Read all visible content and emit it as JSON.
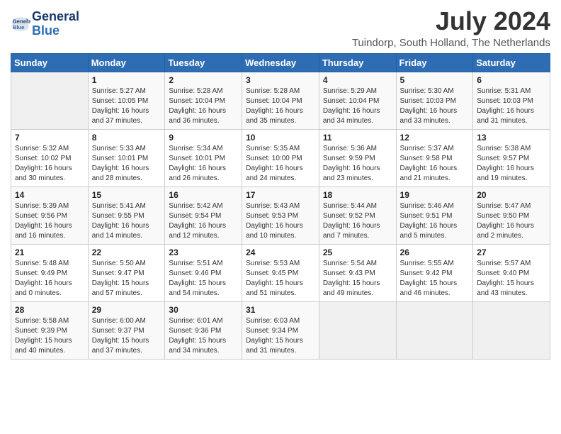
{
  "header": {
    "logo_line1": "General",
    "logo_line2": "Blue",
    "month_title": "July 2024",
    "location": "Tuindorp, South Holland, The Netherlands"
  },
  "days_of_week": [
    "Sunday",
    "Monday",
    "Tuesday",
    "Wednesday",
    "Thursday",
    "Friday",
    "Saturday"
  ],
  "weeks": [
    [
      {
        "day": "",
        "info": ""
      },
      {
        "day": "1",
        "info": "Sunrise: 5:27 AM\nSunset: 10:05 PM\nDaylight: 16 hours\nand 37 minutes."
      },
      {
        "day": "2",
        "info": "Sunrise: 5:28 AM\nSunset: 10:04 PM\nDaylight: 16 hours\nand 36 minutes."
      },
      {
        "day": "3",
        "info": "Sunrise: 5:28 AM\nSunset: 10:04 PM\nDaylight: 16 hours\nand 35 minutes."
      },
      {
        "day": "4",
        "info": "Sunrise: 5:29 AM\nSunset: 10:04 PM\nDaylight: 16 hours\nand 34 minutes."
      },
      {
        "day": "5",
        "info": "Sunrise: 5:30 AM\nSunset: 10:03 PM\nDaylight: 16 hours\nand 33 minutes."
      },
      {
        "day": "6",
        "info": "Sunrise: 5:31 AM\nSunset: 10:03 PM\nDaylight: 16 hours\nand 31 minutes."
      }
    ],
    [
      {
        "day": "7",
        "info": "Sunrise: 5:32 AM\nSunset: 10:02 PM\nDaylight: 16 hours\nand 30 minutes."
      },
      {
        "day": "8",
        "info": "Sunrise: 5:33 AM\nSunset: 10:01 PM\nDaylight: 16 hours\nand 28 minutes."
      },
      {
        "day": "9",
        "info": "Sunrise: 5:34 AM\nSunset: 10:01 PM\nDaylight: 16 hours\nand 26 minutes."
      },
      {
        "day": "10",
        "info": "Sunrise: 5:35 AM\nSunset: 10:00 PM\nDaylight: 16 hours\nand 24 minutes."
      },
      {
        "day": "11",
        "info": "Sunrise: 5:36 AM\nSunset: 9:59 PM\nDaylight: 16 hours\nand 23 minutes."
      },
      {
        "day": "12",
        "info": "Sunrise: 5:37 AM\nSunset: 9:58 PM\nDaylight: 16 hours\nand 21 minutes."
      },
      {
        "day": "13",
        "info": "Sunrise: 5:38 AM\nSunset: 9:57 PM\nDaylight: 16 hours\nand 19 minutes."
      }
    ],
    [
      {
        "day": "14",
        "info": "Sunrise: 5:39 AM\nSunset: 9:56 PM\nDaylight: 16 hours\nand 16 minutes."
      },
      {
        "day": "15",
        "info": "Sunrise: 5:41 AM\nSunset: 9:55 PM\nDaylight: 16 hours\nand 14 minutes."
      },
      {
        "day": "16",
        "info": "Sunrise: 5:42 AM\nSunset: 9:54 PM\nDaylight: 16 hours\nand 12 minutes."
      },
      {
        "day": "17",
        "info": "Sunrise: 5:43 AM\nSunset: 9:53 PM\nDaylight: 16 hours\nand 10 minutes."
      },
      {
        "day": "18",
        "info": "Sunrise: 5:44 AM\nSunset: 9:52 PM\nDaylight: 16 hours\nand 7 minutes."
      },
      {
        "day": "19",
        "info": "Sunrise: 5:46 AM\nSunset: 9:51 PM\nDaylight: 16 hours\nand 5 minutes."
      },
      {
        "day": "20",
        "info": "Sunrise: 5:47 AM\nSunset: 9:50 PM\nDaylight: 16 hours\nand 2 minutes."
      }
    ],
    [
      {
        "day": "21",
        "info": "Sunrise: 5:48 AM\nSunset: 9:49 PM\nDaylight: 16 hours\nand 0 minutes."
      },
      {
        "day": "22",
        "info": "Sunrise: 5:50 AM\nSunset: 9:47 PM\nDaylight: 15 hours\nand 57 minutes."
      },
      {
        "day": "23",
        "info": "Sunrise: 5:51 AM\nSunset: 9:46 PM\nDaylight: 15 hours\nand 54 minutes."
      },
      {
        "day": "24",
        "info": "Sunrise: 5:53 AM\nSunset: 9:45 PM\nDaylight: 15 hours\nand 51 minutes."
      },
      {
        "day": "25",
        "info": "Sunrise: 5:54 AM\nSunset: 9:43 PM\nDaylight: 15 hours\nand 49 minutes."
      },
      {
        "day": "26",
        "info": "Sunrise: 5:55 AM\nSunset: 9:42 PM\nDaylight: 15 hours\nand 46 minutes."
      },
      {
        "day": "27",
        "info": "Sunrise: 5:57 AM\nSunset: 9:40 PM\nDaylight: 15 hours\nand 43 minutes."
      }
    ],
    [
      {
        "day": "28",
        "info": "Sunrise: 5:58 AM\nSunset: 9:39 PM\nDaylight: 15 hours\nand 40 minutes."
      },
      {
        "day": "29",
        "info": "Sunrise: 6:00 AM\nSunset: 9:37 PM\nDaylight: 15 hours\nand 37 minutes."
      },
      {
        "day": "30",
        "info": "Sunrise: 6:01 AM\nSunset: 9:36 PM\nDaylight: 15 hours\nand 34 minutes."
      },
      {
        "day": "31",
        "info": "Sunrise: 6:03 AM\nSunset: 9:34 PM\nDaylight: 15 hours\nand 31 minutes."
      },
      {
        "day": "",
        "info": ""
      },
      {
        "day": "",
        "info": ""
      },
      {
        "day": "",
        "info": ""
      }
    ]
  ]
}
